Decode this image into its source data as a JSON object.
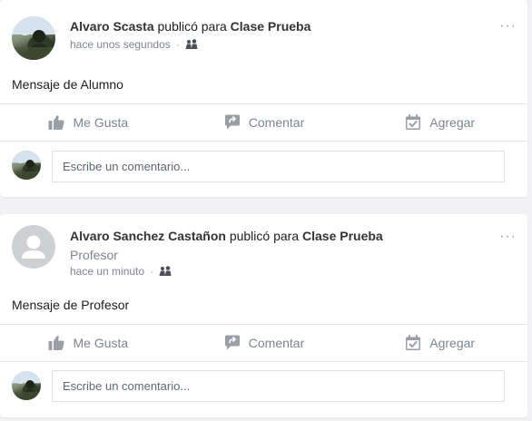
{
  "posts": [
    {
      "author": "Alvaro Scasta",
      "verb": "publicó para",
      "target": "Clase Prueba",
      "role": "",
      "time": "hace unos segundos",
      "separator": "·",
      "message": "Mensaje de Alumno",
      "more": "···",
      "actions": {
        "like": "Me Gusta",
        "comment": "Comentar",
        "add": "Agregar"
      },
      "comment_placeholder": "Escribe un comentario..."
    },
    {
      "author": "Alvaro Sanchez Castañon",
      "verb": "publicó para",
      "target": "Clase Prueba",
      "role": "Profesor",
      "time": "hace un minuto",
      "separator": "·",
      "message": "Mensaje de Profesor",
      "more": "···",
      "actions": {
        "like": "Me Gusta",
        "comment": "Comentar",
        "add": "Agregar"
      },
      "comment_placeholder": "Escribe un comentario..."
    }
  ],
  "icons": {
    "like": "thumbs-up-icon",
    "comment": "speech-bubble-icon",
    "add": "calendar-check-icon",
    "audience": "group-icon",
    "more": "more-options-icon"
  },
  "colors": {
    "background": "#f2f2f4",
    "card": "#ffffff",
    "muted_text": "#7d8590",
    "icon": "#9a9ea6",
    "divider": "#e5e6ea"
  }
}
